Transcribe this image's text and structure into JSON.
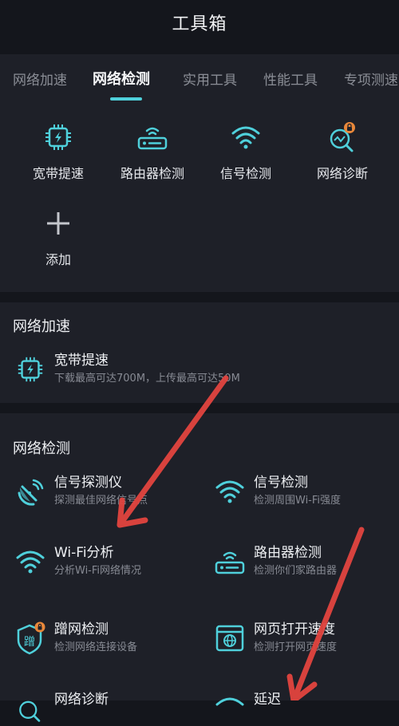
{
  "header": {
    "title": "工具箱"
  },
  "tabs": [
    "网络加速",
    "网络检测",
    "实用工具",
    "性能工具",
    "专项测速"
  ],
  "quick_actions": [
    {
      "label": "宽带提速",
      "icon": "chip-bolt-icon"
    },
    {
      "label": "路由器检测",
      "icon": "router-icon"
    },
    {
      "label": "信号检测",
      "icon": "wifi-icon"
    },
    {
      "label": "网络诊断",
      "icon": "network-diagnose-icon"
    },
    {
      "label": "添加",
      "icon": "plus-icon"
    }
  ],
  "accel_section": {
    "title": "网络加速",
    "items": [
      {
        "name": "宽带提速",
        "desc": "下载最高可达700M，上传最高可达50M",
        "icon": "chip-bolt-icon"
      }
    ]
  },
  "detect_section": {
    "title": "网络检测",
    "items": [
      {
        "name": "信号探测仪",
        "desc": "探测最佳网络信号点",
        "icon": "radar-icon"
      },
      {
        "name": "信号检测",
        "desc": "检测周围Wi-Fi强度",
        "icon": "wifi-icon"
      },
      {
        "name": "Wi-Fi分析",
        "desc": "分析Wi-Fi网络情况",
        "icon": "wifi-icon"
      },
      {
        "name": "路由器检测",
        "desc": "检测你们家路由器",
        "icon": "router-icon"
      },
      {
        "name": "蹭网检测",
        "desc": "检测网络连接设备",
        "icon": "shield-icon"
      },
      {
        "name": "网页打开速度",
        "desc": "检测打开网页速度",
        "icon": "webpage-icon"
      },
      {
        "name": "网络诊断",
        "desc": "",
        "icon": "network-diagnose-icon"
      },
      {
        "name": "延迟",
        "desc": "",
        "icon": "ping-icon"
      }
    ]
  },
  "colors": {
    "accent": "#4fd0db",
    "background": "#14161c",
    "panel": "#1e2028",
    "arrow": "#e2443f"
  }
}
